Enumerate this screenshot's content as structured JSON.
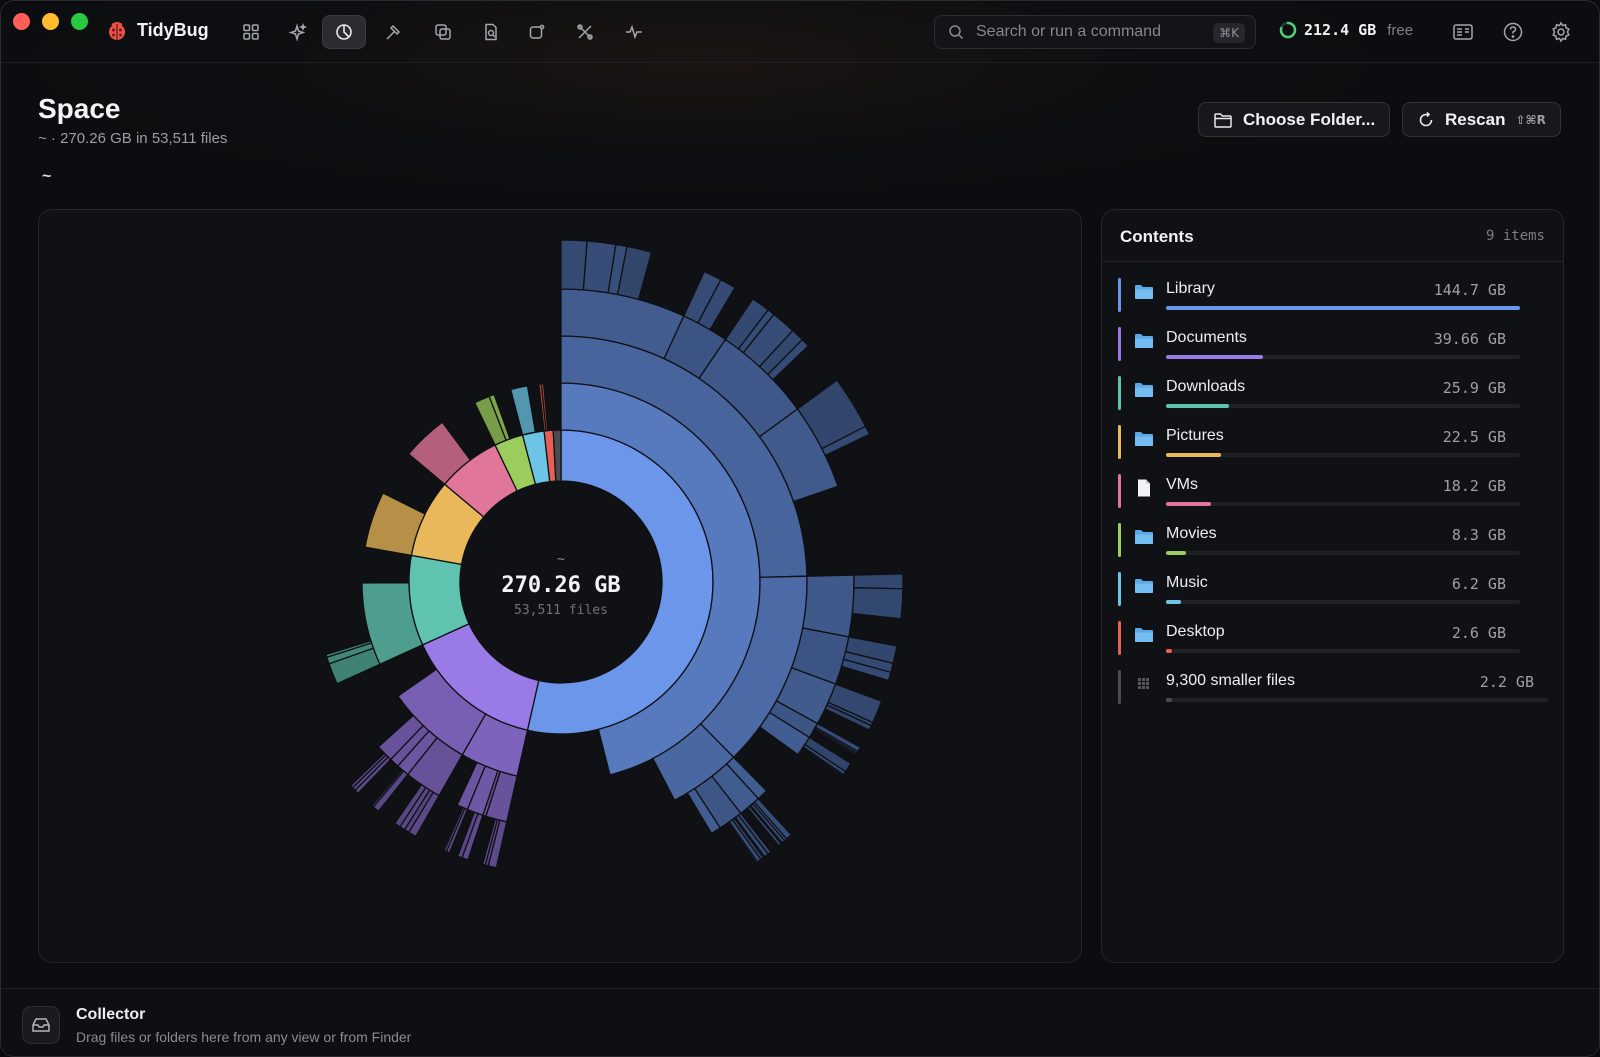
{
  "app": {
    "name": "TidyBug",
    "search": {
      "placeholder": "Search or run a command",
      "shortcut": "⌘K"
    },
    "free_space": {
      "value": "212.4 GB",
      "unit": "free",
      "used_fraction": 0.79
    },
    "toolbar_icons": [
      "grid-icon",
      "sparkle-icon",
      "pie-chart-icon",
      "hammer-icon",
      "duplicate-icon",
      "report-icon",
      "app-icon",
      "tools-icon",
      "activity-icon"
    ]
  },
  "header": {
    "title": "Space",
    "subtitle": "~ · 270.26 GB in 53,511 files",
    "breadcrumb": "~",
    "choose_folder": "Choose Folder...",
    "rescan": "Rescan",
    "rescan_shortcut": "⇧⌘R"
  },
  "chart": {
    "center_label": "~",
    "center_total": "270.26 GB",
    "center_files": "53,511 files"
  },
  "contents": {
    "title": "Contents",
    "count": "9 items",
    "items": [
      {
        "name": "Library",
        "size": "144.7 GB",
        "gb": 144.7,
        "color": "#6b96ea",
        "icon": "folder-icon"
      },
      {
        "name": "Documents",
        "size": "39.66 GB",
        "gb": 39.66,
        "color": "#9a7ae6",
        "icon": "folder-icon"
      },
      {
        "name": "Downloads",
        "size": "25.9 GB",
        "gb": 25.9,
        "color": "#5fc3b0",
        "icon": "folder-icon"
      },
      {
        "name": "Pictures",
        "size": "22.5 GB",
        "gb": 22.5,
        "color": "#e8b85a",
        "icon": "folder-icon"
      },
      {
        "name": "VMs",
        "size": "18.2 GB",
        "gb": 18.2,
        "color": "#e0769a",
        "icon": "file-icon"
      },
      {
        "name": "Movies",
        "size": "8.3 GB",
        "gb": 8.3,
        "color": "#9ccc5e",
        "icon": "folder-icon"
      },
      {
        "name": "Music",
        "size": "6.2 GB",
        "gb": 6.2,
        "color": "#6cc4e6",
        "icon": "folder-icon"
      },
      {
        "name": "Desktop",
        "size": "2.6 GB",
        "gb": 2.6,
        "color": "#e86054",
        "icon": "folder-icon"
      },
      {
        "name": "9,300 smaller files",
        "size": "2.2 GB",
        "gb": 2.2,
        "color": "#4a4c52",
        "icon": "grid-dots-icon"
      }
    ]
  },
  "collector": {
    "title": "Collector",
    "subtitle": "Drag files or folders here from any view or from Finder"
  }
}
